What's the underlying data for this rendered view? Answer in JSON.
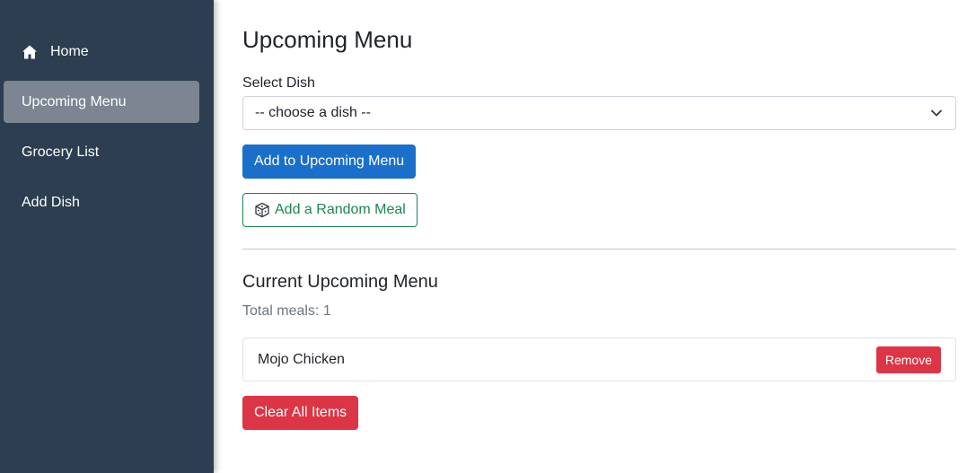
{
  "sidebar": {
    "items": [
      {
        "label": "Home",
        "icon": "home-icon",
        "active": false
      },
      {
        "label": "Upcoming Menu",
        "active": true
      },
      {
        "label": "Grocery List",
        "active": false
      },
      {
        "label": "Add Dish",
        "active": false
      }
    ]
  },
  "main": {
    "title": "Upcoming Menu",
    "select_label": "Select Dish",
    "select_value": "-- choose a dish --",
    "add_button": "Add to Upcoming Menu",
    "random_button": "Add a Random Meal",
    "current_title": "Current Upcoming Menu",
    "total_meals": "Total meals: 1",
    "items": [
      {
        "name": "Mojo Chicken",
        "remove_label": "Remove"
      }
    ],
    "clear_button": "Clear All Items"
  },
  "colors": {
    "sidebar_bg": "#2c3e50",
    "active_bg": "#7c8591",
    "primary": "#1a6fca",
    "success": "#198754",
    "danger": "#dc3545"
  }
}
